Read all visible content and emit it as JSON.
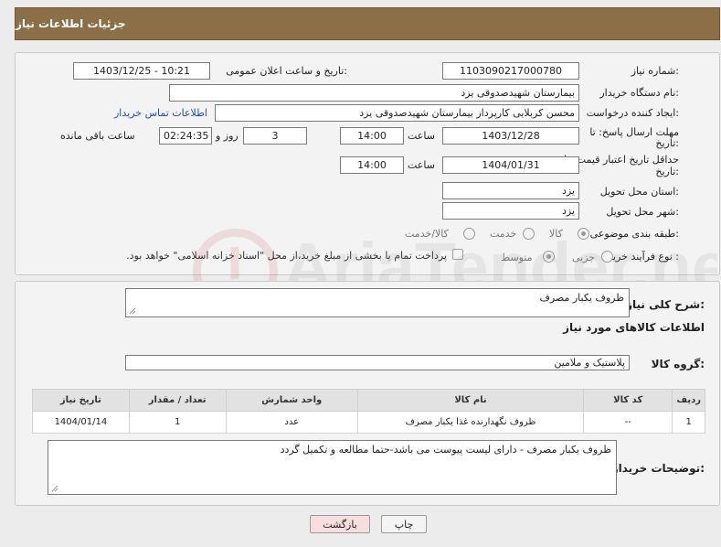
{
  "header": {
    "title": "جزئیات اطلاعات نیاز"
  },
  "form": {
    "need_number_label": "شماره نیاز:",
    "need_number": "1103090217000780",
    "announce_label": "تاریخ و ساعت اعلان عمومی:",
    "announce_value": "1403/12/25 - 10:21",
    "buyer_label": "نام دستگاه خریدار:",
    "buyer_value": "بیمارستان شهیدصدوقی یزد",
    "creator_label": "ایجاد کننده درخواست:",
    "creator_value": "محسن کربلایی کارپرداز بیمارستان شهیدصدوقی یزد",
    "contact_link": "اطلاعات تماس خریدار",
    "reply_label_1": "مهلت ارسال پاسخ: تا",
    "reply_label_2": "تاریخ:",
    "reply_date": "1403/12/28",
    "time_label": "ساعت",
    "reply_time": "14:00",
    "days_value": "3",
    "days_label": "روز و",
    "remaining_value": "02:24:35",
    "remaining_label": "ساعت باقی مانده",
    "validity_label_1": "حداقل تاریخ اعتبار قیمت: تا",
    "validity_label_2": "تاریخ:",
    "validity_date": "1404/01/31",
    "validity_time": "14:00",
    "province_label": "استان محل تحویل:",
    "province_value": "یزد",
    "city_label": "شهر محل تحویل:",
    "city_value": "یزد",
    "category_label": "طبقه بندی موضوعی:",
    "category_options": [
      "کالا",
      "خدمت",
      "کالا/خدمت"
    ],
    "process_label": "نوع فرآیند خرید :",
    "process_options": [
      "جزیی",
      "متوسط"
    ],
    "payment_note": "پرداخت تمام یا بخشی از مبلغ خرید،از محل \"اسناد خزانه اسلامی\" خواهد بود."
  },
  "details": {
    "desc_label": "شرح کلی نیاز:",
    "desc_value": "ظروف یکبار مصرف",
    "items_title": "اطلاعات کالاهای مورد نیاز",
    "group_label": "گروه کالا:",
    "group_value": "پلاستیک و ملامین",
    "table": {
      "headers": [
        "ردیف",
        "کد کالا",
        "نام کالا",
        "واحد شمارش",
        "تعداد / مقدار",
        "تاریخ نیاز"
      ],
      "rows": [
        [
          "1",
          "--",
          "ظروف نگهدارنده غذا یکبار مصرف",
          "عدد",
          "1",
          "1404/01/14"
        ]
      ]
    },
    "buyer_notes_label": "توضیحات خریدار:",
    "buyer_notes_value": "ظروف یکبار مصرف - دارای لیست پیوست می باشد-حتما مطالعه و تکمیل گردد"
  },
  "buttons": {
    "print": "چاپ",
    "back": "بازگشت"
  },
  "watermark": {
    "text": "AriaTender.neT"
  },
  "colors": {
    "header_bg": "#8b6f47",
    "link": "#1f4fb8",
    "back_button_bg": "#f7dede"
  }
}
